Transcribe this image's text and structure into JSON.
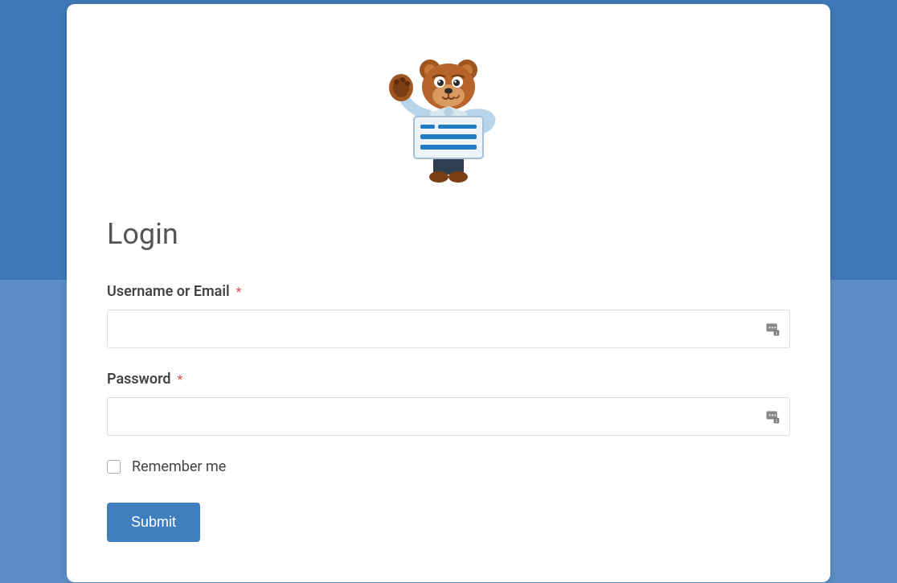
{
  "form": {
    "title": "Login",
    "username": {
      "label": "Username or Email",
      "required_marker": "*",
      "value": "",
      "placeholder": ""
    },
    "password": {
      "label": "Password",
      "required_marker": "*",
      "value": "",
      "placeholder": ""
    },
    "remember": {
      "label": "Remember me",
      "checked": false
    },
    "submit_label": "Submit"
  },
  "colors": {
    "accent": "#3f7fc0",
    "bg_top": "#3e78b6",
    "bg_bottom": "#5a8ec4"
  }
}
